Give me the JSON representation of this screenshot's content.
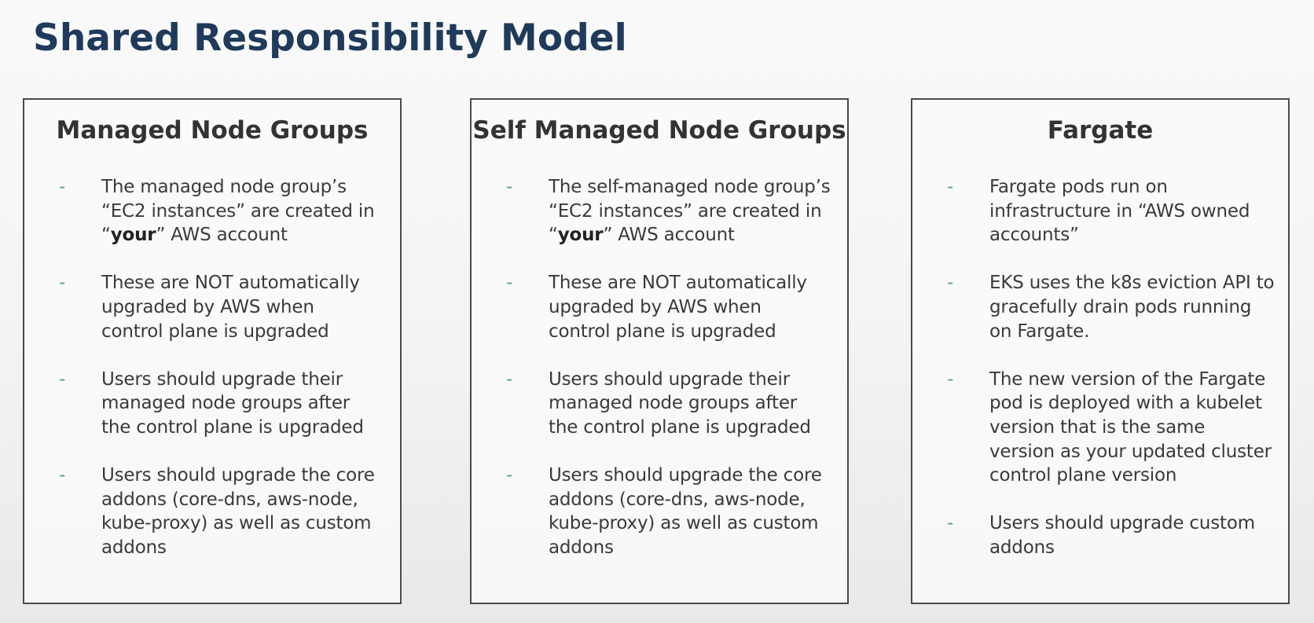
{
  "title": "Shared Responsibility Model",
  "cards": [
    {
      "heading": "Managed Node Groups",
      "bullets": [
        {
          "lines": [
            "The managed node group’s",
            "“EC2 instances” are created in"
          ],
          "last_pre": "“",
          "last_bold": "your",
          "last_post": "” AWS account"
        },
        {
          "lines": [
            "These are NOT automatically",
            "upgraded by AWS when",
            "control plane is upgraded"
          ]
        },
        {
          "lines": [
            "Users should upgrade their",
            "managed node groups after",
            "the control plane is upgraded"
          ]
        },
        {
          "lines": [
            "Users should upgrade the core",
            "addons  (core-dns, aws-node,",
            "kube-proxy) as well as custom",
            "addons"
          ]
        }
      ]
    },
    {
      "heading": "Self Managed Node Groups",
      "bullets": [
        {
          "lines": [
            "The self-managed node group’s",
            "“EC2 instances” are created in"
          ],
          "last_pre": "“",
          "last_bold": "your",
          "last_post": "” AWS account"
        },
        {
          "lines": [
            "These are NOT automatically",
            "upgraded by AWS when",
            "control plane is upgraded"
          ]
        },
        {
          "lines": [
            "Users should upgrade their",
            "managed node groups after",
            "the control plane is upgraded"
          ]
        },
        {
          "lines": [
            "Users should upgrade the core",
            "addons  (core-dns, aws-node,",
            "kube-proxy) as well as custom",
            "addons"
          ]
        }
      ]
    },
    {
      "heading": "Fargate",
      "bullets": [
        {
          "lines": [
            "Fargate pods run on",
            "infrastructure in “AWS owned",
            "accounts”"
          ]
        },
        {
          "lines": [
            "EKS uses the k8s eviction API to",
            "gracefully drain pods running",
            "on Fargate."
          ]
        },
        {
          "lines": [
            "The new version of the Fargate",
            "pod is deployed with a kubelet",
            "version that is the same",
            "version as your updated cluster",
            "control plane version"
          ]
        },
        {
          "lines": [
            "Users should upgrade custom",
            "addons"
          ]
        }
      ]
    }
  ],
  "bullet_marker": "-"
}
